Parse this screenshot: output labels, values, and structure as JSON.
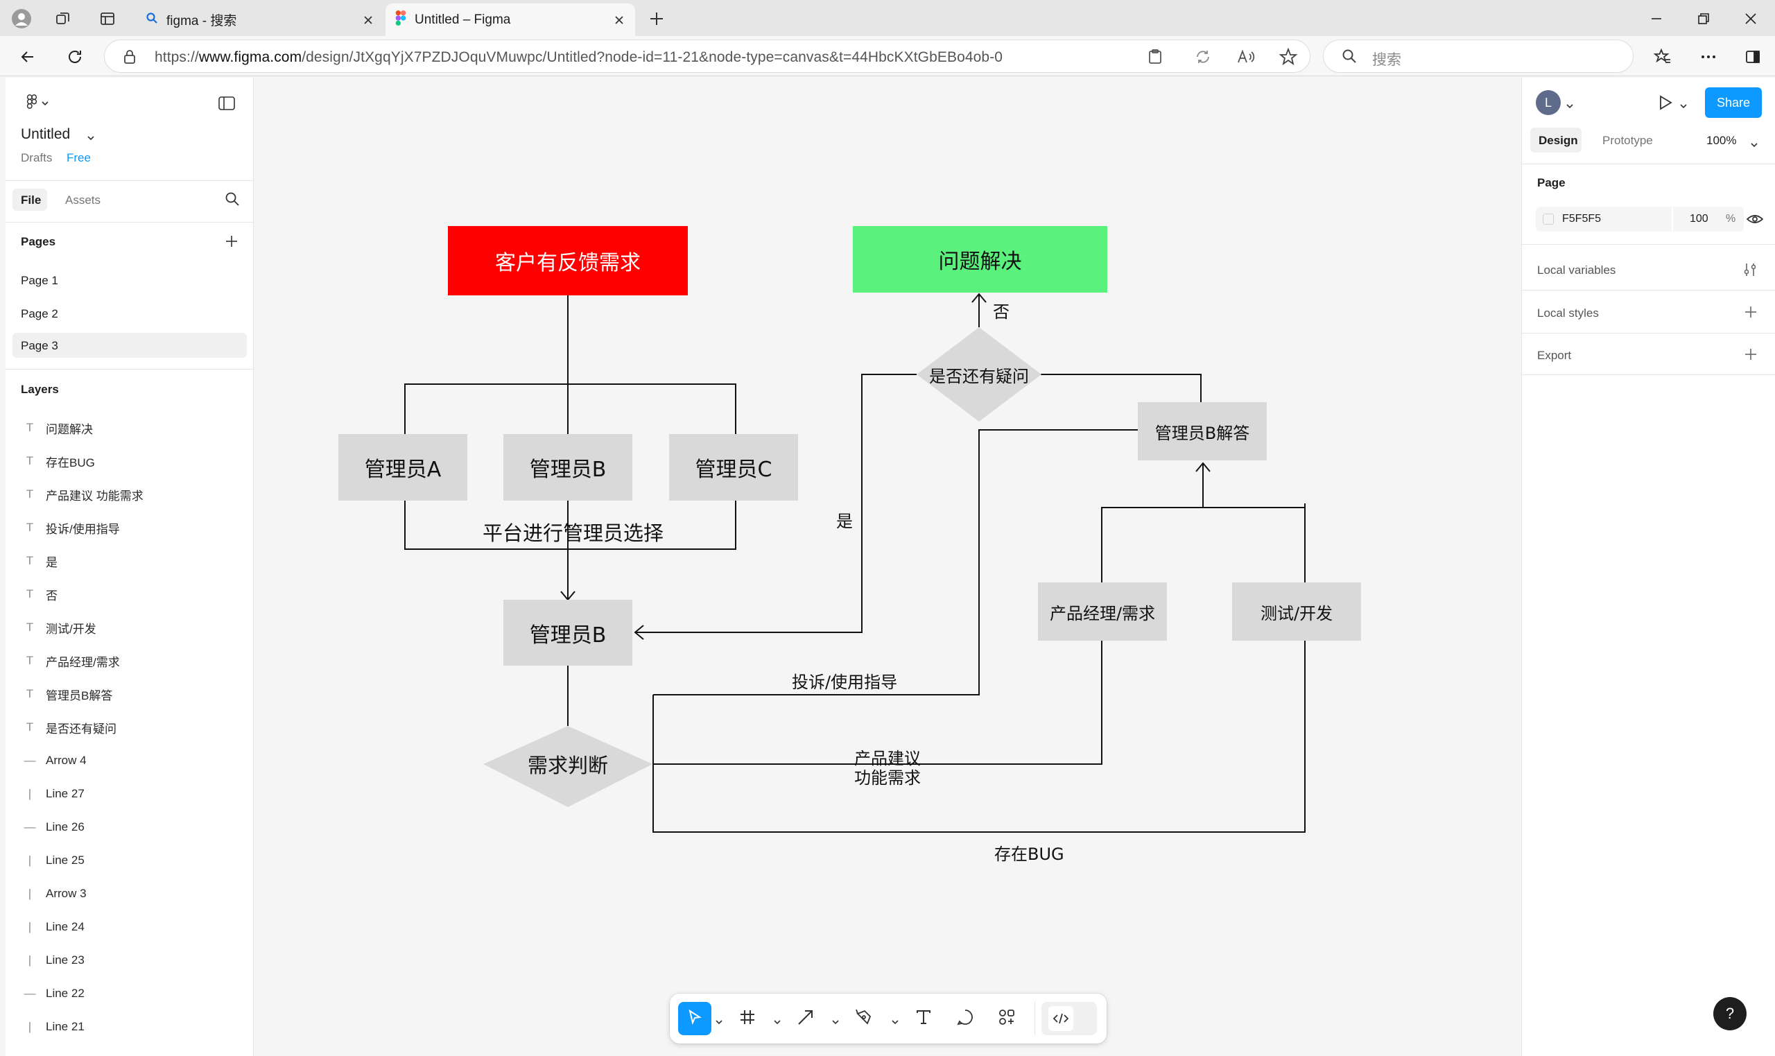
{
  "browser": {
    "tabs": [
      {
        "label": "figma - 搜索",
        "active": false
      },
      {
        "label": "Untitled – Figma",
        "active": true
      }
    ],
    "url_prefix": "https://",
    "url_host": "www.figma.com",
    "url_path": "/design/JtXgqYjX7PZDJOquVMuwpc/Untitled?node-id=11-21&node-type=canvas&t=44HbcKXtGbEBo4ob-0",
    "search_placeholder": "搜索"
  },
  "left_panel": {
    "file_title": "Untitled",
    "drafts_label": "Drafts",
    "plan_label": "Free",
    "tabs": {
      "file": "File",
      "assets": "Assets"
    },
    "pages_heading": "Pages",
    "pages": [
      "Page 1",
      "Page 2",
      "Page 3"
    ],
    "layers_heading": "Layers",
    "layers": [
      {
        "name": "问题解决",
        "icon": "text-icon"
      },
      {
        "name": "存在BUG",
        "icon": "text-icon"
      },
      {
        "name": "产品建议 功能需求",
        "icon": "text-icon"
      },
      {
        "name": "投诉/使用指导",
        "icon": "text-icon"
      },
      {
        "name": "是",
        "icon": "text-icon"
      },
      {
        "name": "否",
        "icon": "text-icon"
      },
      {
        "name": "测试/开发",
        "icon": "text-icon"
      },
      {
        "name": "产品经理/需求",
        "icon": "text-icon"
      },
      {
        "name": "管理员B解答",
        "icon": "text-icon"
      },
      {
        "name": "是否还有疑问",
        "icon": "text-icon"
      },
      {
        "name": "Arrow 4",
        "icon": "horizontal-line-icon"
      },
      {
        "name": "Line 27",
        "icon": "vertical-line-icon"
      },
      {
        "name": "Line 26",
        "icon": "horizontal-line-icon"
      },
      {
        "name": "Line 25",
        "icon": "vertical-line-icon"
      },
      {
        "name": "Arrow 3",
        "icon": "vertical-line-icon"
      },
      {
        "name": "Line 24",
        "icon": "vertical-line-icon"
      },
      {
        "name": "Line 23",
        "icon": "vertical-line-icon"
      },
      {
        "name": "Line 22",
        "icon": "horizontal-line-icon"
      },
      {
        "name": "Line 21",
        "icon": "vertical-line-icon"
      }
    ]
  },
  "right_panel": {
    "avatar_initial": "L",
    "share_label": "Share",
    "tabs": {
      "design": "Design",
      "prototype": "Prototype"
    },
    "zoom": "100%",
    "page_heading": "Page",
    "page_color": "F5F5F5",
    "page_opacity": "100",
    "percent": "%",
    "local_variables": "Local variables",
    "local_styles": "Local styles",
    "export": "Export",
    "help": "?"
  },
  "diagram": {
    "customer_feedback": "客户有反馈需求",
    "problem_solved": "问题解决",
    "no_label": "否",
    "yes_label": "是",
    "still_questions": "是否还有疑问",
    "admin_a": "管理员A",
    "admin_b": "管理员B",
    "admin_c": "管理员C",
    "platform_select": "平台进行管理员选择",
    "admin_b_main": "管理员B",
    "admin_b_answer": "管理员B解答",
    "product_manager": "产品经理/需求",
    "test_dev": "测试/开发",
    "complaint_guide": "投诉/使用指导",
    "product_suggestion_1": "产品建议",
    "product_suggestion_2": "功能需求",
    "requirement_judge": "需求判断",
    "bug_exists": "存在BUG",
    "colors": {
      "red_box": "#ff0000",
      "green_box": "#5af17c",
      "gray_box": "#d9d9d9",
      "canvas": "#f5f5f5",
      "accent": "#0d99ff"
    }
  }
}
